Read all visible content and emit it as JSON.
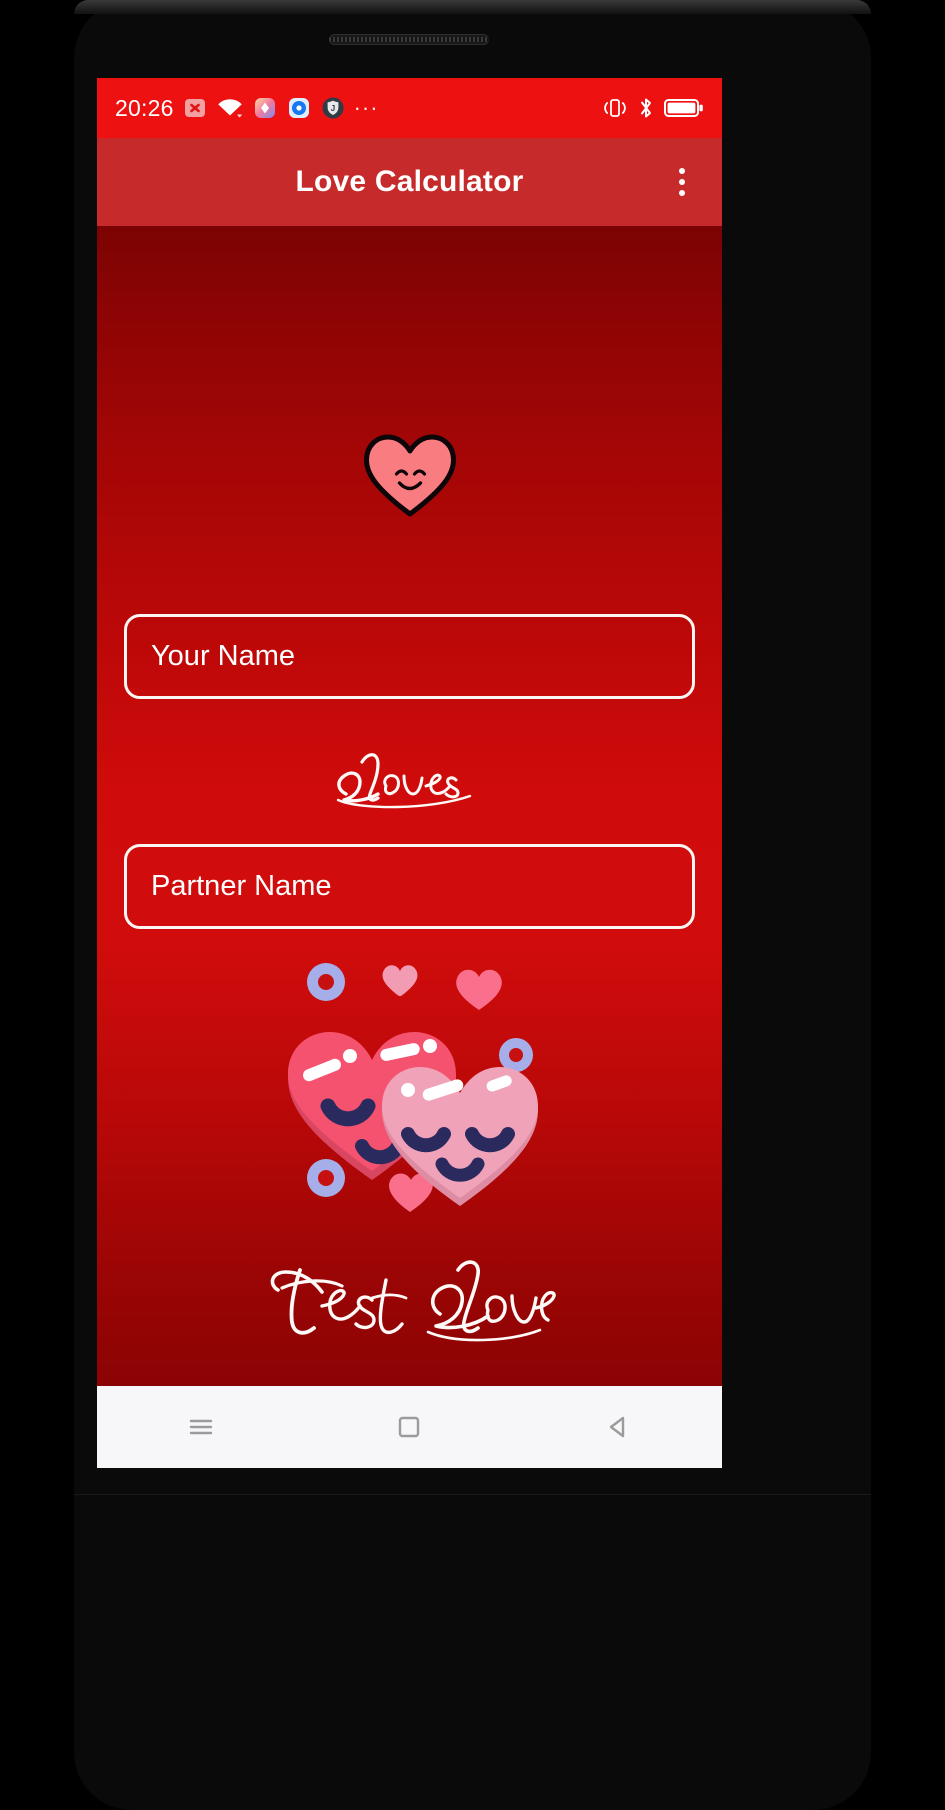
{
  "device": {
    "frame_color": "#000000",
    "screen_bg": "#a00505"
  },
  "status_bar": {
    "background": "#ed1111",
    "clock": "20:26",
    "overflow_dots": "···",
    "left_icons": [
      {
        "name": "app-notification-x-icon",
        "color": "#f19a9a"
      },
      {
        "name": "wifi-icon",
        "color": "#ffffff"
      },
      {
        "name": "app-notification-gradient-icon",
        "color": "#f3c27a"
      },
      {
        "name": "app-notification-blue-icon",
        "color": "#1e88ff"
      },
      {
        "name": "app-notification-shield-icon",
        "color": "#2f3b45"
      }
    ],
    "right_icons": [
      {
        "name": "vibrate-icon",
        "color": "#ffffff"
      },
      {
        "name": "bluetooth-icon",
        "color": "#ffffff"
      },
      {
        "name": "battery-full-icon",
        "color": "#ffffff"
      }
    ]
  },
  "app_bar": {
    "background": "#c62a2a",
    "title": "Love Calculator",
    "overflow_menu_name": "overflow-menu-button"
  },
  "main": {
    "background_gradient_from": "#7c0303",
    "background_gradient_mid": "#d00c0c",
    "background_gradient_to": "#800202",
    "top_heart": {
      "name": "smiling-heart-icon",
      "fill": "#f97c80",
      "outline": "#0d0508"
    },
    "your_name": {
      "value": "",
      "placeholder": "Your Name",
      "border_color": "#fbf6f4",
      "text_color": "#ffffff"
    },
    "loves_label": "Loves",
    "partner_name": {
      "value": "",
      "placeholder": "Partner Name",
      "border_color": "#fbf6f4",
      "text_color": "#ffffff"
    },
    "hearts_illustration": {
      "name": "couple-hearts-illustration",
      "heart_dark_pink": "#f4526e",
      "heart_light_pink": "#f0a3b8",
      "heart_shadow_dark": "#d94662",
      "heart_shadow_light": "#dd8ca3",
      "face_navy": "#2a2a5e",
      "highlight_white": "#ffffff",
      "ring_lavender": "#a5aee8",
      "small_heart_pink": "#fa6f8b",
      "small_heart_light": "#f29cb4"
    },
    "test_love_label_1": "Test",
    "test_love_label_2": "Love"
  },
  "nav_bar": {
    "background": "#f7f7f9",
    "icon_color": "#9b9b9b",
    "buttons": [
      {
        "name": "nav-recents-button",
        "glyph": "menu"
      },
      {
        "name": "nav-home-button",
        "glyph": "square"
      },
      {
        "name": "nav-back-button",
        "glyph": "triangle-left"
      }
    ]
  }
}
